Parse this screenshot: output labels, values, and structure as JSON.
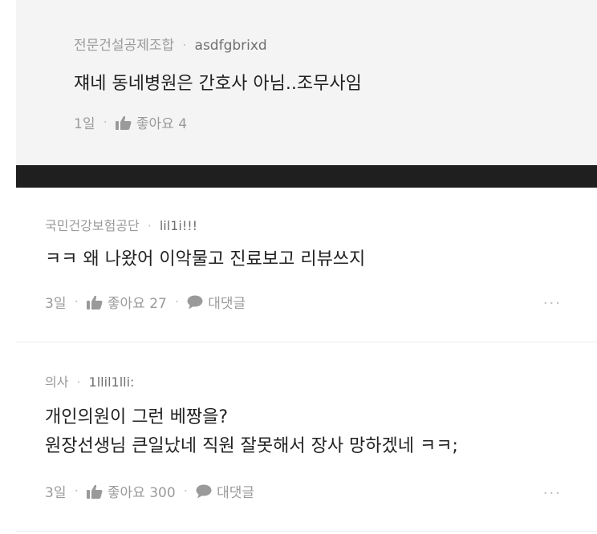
{
  "reply": {
    "company": "전문건설공제조합",
    "separator": "·",
    "username": "asdfgbrixd",
    "text": "쟤네 동네병원은 간호사 아님..조무사임",
    "time": "1일",
    "like_label": "좋아요 4"
  },
  "comments": [
    {
      "company": "국민건강보험공단",
      "separator": "·",
      "username": "lil1i!!!",
      "lines": [
        "ㅋㅋ 왜 나왔어 이악물고 진료보고 리뷰쓰지"
      ],
      "time": "3일",
      "like_label": "좋아요 27",
      "reply_label": "대댓글",
      "more": "···"
    },
    {
      "company": "의사",
      "separator": "·",
      "username": "1llil1lli:",
      "lines": [
        "개인의원이 그런 베짱을?",
        "원장선생님 큰일났네 직원 잘못해서 장사 망하겠네 ㅋㅋ;"
      ],
      "time": "3일",
      "like_label": "좋아요 300",
      "reply_label": "대댓글",
      "more": "···"
    }
  ],
  "colors": {
    "reply_background": "#f4f4f4",
    "dark_band": "#1f1f1f",
    "meta_text": "#9a9a9a",
    "body_text": "#222222"
  },
  "icons": {
    "like": "thumbs-up-icon",
    "reply": "speech-bubble-icon",
    "more": "more-dots-icon"
  }
}
